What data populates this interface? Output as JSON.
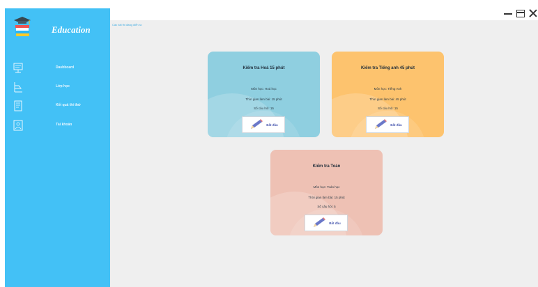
{
  "app": {
    "title": "Education",
    "breadcrumb": "Các bài thi đang diễn ra"
  },
  "sidebar": {
    "items": [
      {
        "label": "Dashboard",
        "icon": "dashboard-icon"
      },
      {
        "label": "Lớp học",
        "icon": "class-icon"
      },
      {
        "label": "Kết quả thi thử",
        "icon": "results-icon"
      },
      {
        "label": "Tài khoản",
        "icon": "account-icon"
      }
    ]
  },
  "cards": [
    {
      "title": "Kiểm tra Hoá 15 phút",
      "subject": "Môn học: Hoá học",
      "time": "Thời gian làm bài: 15 phút",
      "questions": "Số câu hỏi: 15",
      "button": "Bắt đầu",
      "color": "#8fcfe0"
    },
    {
      "title": "Kiểm tra Tiếng anh 45 phút",
      "subject": "Môn học: Tiếng Anh",
      "time": "Thời gian làm bài: 45 phút",
      "questions": "Số câu hỏi: 15",
      "button": "Bắt đầu",
      "color": "#fdc36e"
    },
    {
      "title": "Kiểm tra Toán",
      "subject": "Môn học: Toán học",
      "time": "Thời gian làm bài: 15 phút",
      "questions": "Số câu hỏi: 5",
      "button": "Bắt đầu",
      "color": "#eec1b4"
    }
  ],
  "colors": {
    "sidebar": "#43c1f6",
    "main_bg": "#efefef",
    "accent": "#3aa9e2"
  }
}
